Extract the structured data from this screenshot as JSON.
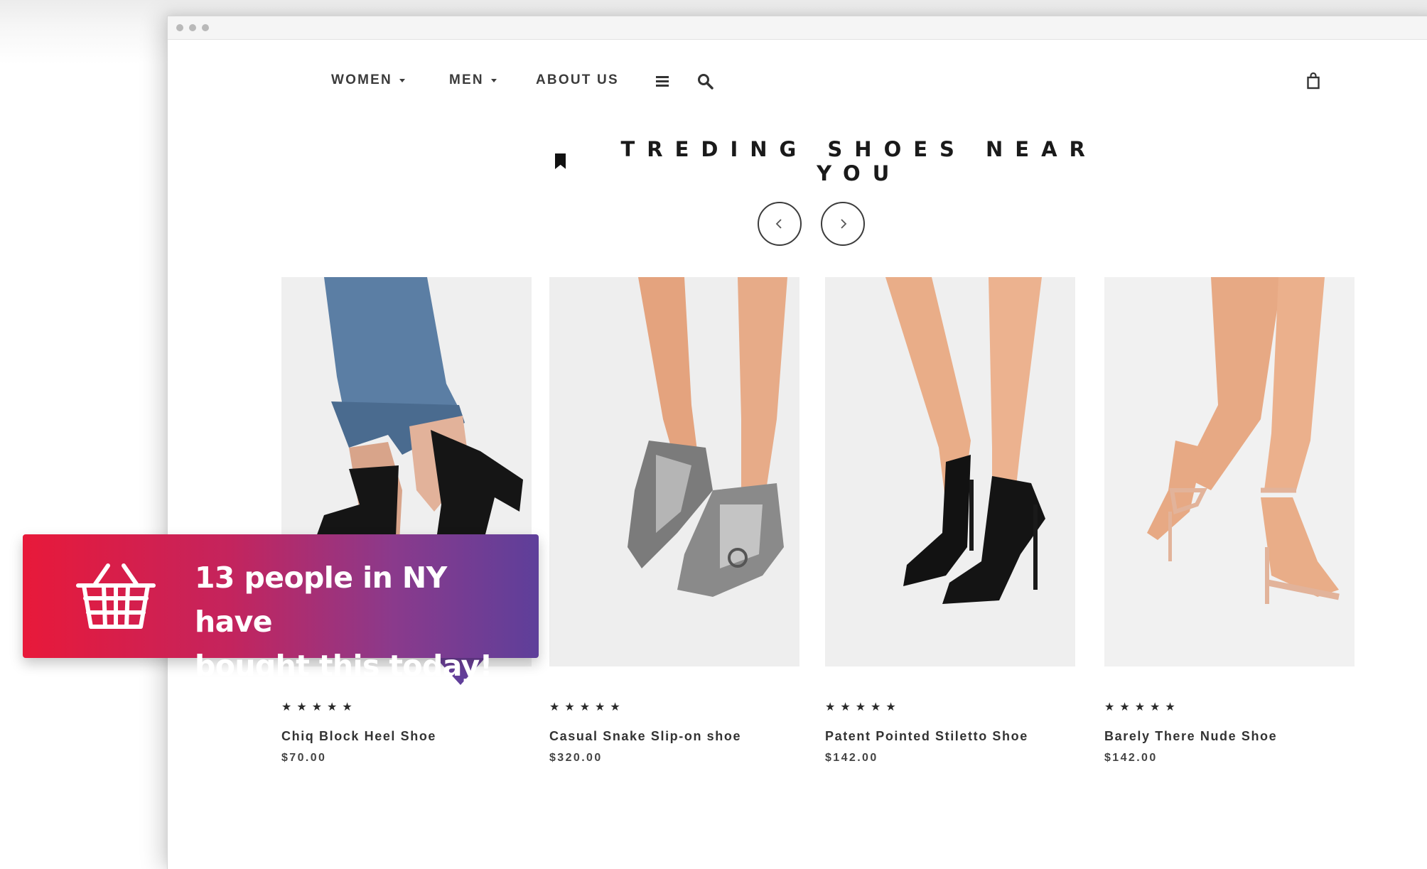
{
  "nav": {
    "items": [
      {
        "label": "WOMEN",
        "dropdown": true
      },
      {
        "label": "MEN",
        "dropdown": true
      },
      {
        "label": "ABOUT US",
        "dropdown": false
      }
    ],
    "icons": [
      "menu-icon",
      "search-icon",
      "shopping-bag-icon"
    ]
  },
  "section": {
    "title": "TREDING SHOES NEAR YOU",
    "title_icon": "bookmark-icon",
    "prev_icon": "chevron-left-icon",
    "next_icon": "chevron-right-icon"
  },
  "products": [
    {
      "name": "Chiq Block Heel Shoe",
      "price": "$70.00",
      "rating": 5,
      "stars": "★★★★★"
    },
    {
      "name": "Casual Snake Slip-on shoe",
      "price": "$320.00",
      "rating": 5,
      "stars": "★★★★★"
    },
    {
      "name": "Patent Pointed Stiletto Shoe",
      "price": "$142.00",
      "rating": 5,
      "stars": "★★★★★"
    },
    {
      "name": "Barely There Nude Shoe",
      "price": "$142.00",
      "rating": 5,
      "stars": "★★★★★"
    }
  ],
  "toast": {
    "line1": "13 people in NY have",
    "line2": "bought this today!",
    "icon": "shopping-basket-icon",
    "gradient_start": "#e8193a",
    "gradient_end": "#5e3f9a"
  }
}
